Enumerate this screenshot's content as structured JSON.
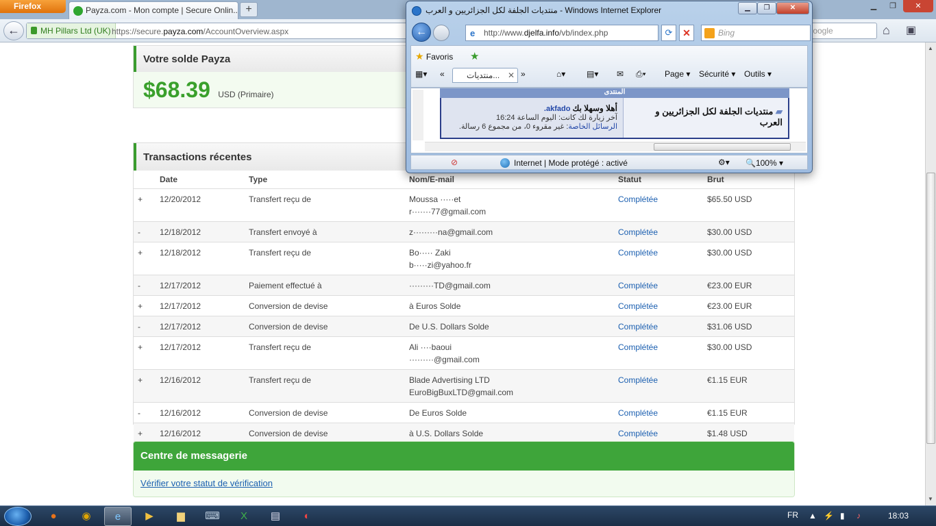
{
  "firefox": {
    "menu_label": "Firefox",
    "tab_title": "Payza.com - Mon compte | Secure Onlin...",
    "new_tab": "+",
    "identity": "MH Pillars Ltd (UK)",
    "url_prefix": "https://secure.",
    "url_domain": "payza.com",
    "url_path": "/AccountOverview.aspx",
    "search_placeholder": "Google"
  },
  "balance": {
    "title": "Votre solde Payza",
    "amount": "$68.39",
    "currency": "USD (Primaire)"
  },
  "transactions": {
    "title": "Transactions récentes",
    "headers": [
      "Date",
      "Type",
      "Nom/E-mail",
      "Statut",
      "Brut"
    ],
    "rows": [
      {
        "sign": "+",
        "date": "12/20/2012",
        "type": "Transfert reçu de",
        "name": "Moussa ·····et",
        "email": "r·······77@gmail.com",
        "status": "Complétée",
        "amount": "$65.50 USD"
      },
      {
        "sign": "-",
        "date": "12/18/2012",
        "type": "Transfert envoyé à",
        "name": "z·········na@gmail.com",
        "email": "",
        "status": "Complétée",
        "amount": "$30.00 USD"
      },
      {
        "sign": "+",
        "date": "12/18/2012",
        "type": "Transfert reçu de",
        "name": "Bo····· Zaki",
        "email": "b·····zi@yahoo.fr",
        "status": "Complétée",
        "amount": "$30.00 USD"
      },
      {
        "sign": "-",
        "date": "12/17/2012",
        "type": "Paiement effectué à",
        "name": "·········TD@gmail.com",
        "email": "",
        "status": "Complétée",
        "amount": "€23.00 EUR"
      },
      {
        "sign": "+",
        "date": "12/17/2012",
        "type": "Conversion de devise",
        "name": "à Euros Solde",
        "email": "",
        "status": "Complétée",
        "amount": "€23.00 EUR"
      },
      {
        "sign": "-",
        "date": "12/17/2012",
        "type": "Conversion de devise",
        "name": "De U.S. Dollars Solde",
        "email": "",
        "status": "Complétée",
        "amount": "$31.06 USD"
      },
      {
        "sign": "+",
        "date": "12/17/2012",
        "type": "Transfert reçu de",
        "name": "Ali ····baoui",
        "email": "·········@gmail.com",
        "status": "Complétée",
        "amount": "$30.00 USD"
      },
      {
        "sign": "+",
        "date": "12/16/2012",
        "type": "Transfert reçu de",
        "name": "Blade Advertising LTD",
        "email": "EuroBigBuxLTD@gmail.com",
        "status": "Complétée",
        "amount": "€1.15 EUR"
      },
      {
        "sign": "-",
        "date": "12/16/2012",
        "type": "Conversion de devise",
        "name": "De Euros Solde",
        "email": "",
        "status": "Complétée",
        "amount": "€1.15 EUR"
      },
      {
        "sign": "+",
        "date": "12/16/2012",
        "type": "Conversion de devise",
        "name": "à U.S. Dollars Solde",
        "email": "",
        "status": "Complétée",
        "amount": "$1.48 USD"
      }
    ]
  },
  "messages": {
    "title": "Centre de messagerie",
    "link": "Vérifier votre statut de vérification"
  },
  "ie": {
    "title": "منتديات الجلفة لكل الجزائريين و العرب - Windows Internet Explorer",
    "address_prefix": "http://www.",
    "address_domain": "djelfa.info",
    "address_path": "/vb/index.php",
    "search_placeholder": "Bing",
    "favorites": "Favoris",
    "tab_title": "منتديات...",
    "cmd_page": "Page ▾",
    "cmd_security": "Sécurité ▾",
    "cmd_tools": "Outils ▾",
    "forum_top": "المنتدى",
    "forum_name": "منتديات الجلفة لكل الجزائريين و العرب",
    "welcome": "أهلا وسهلا بك",
    "username": "akfado.",
    "last_visit": "آخر زيارة لك كانت: اليوم الساعة 16:24",
    "pm_label": "الرسائل الخاصة",
    "pm_text": ": غير مقروء 0، من مجموع 6 رسالة.",
    "status_zone": "Internet | Mode protégé : activé",
    "zoom": "100%"
  },
  "taskbar": {
    "lang": "FR",
    "clock": "18:03"
  },
  "colors": {
    "payza_green": "#3aa02c",
    "link_blue": "#1b5fb0",
    "minus_red": "#cc3333"
  }
}
